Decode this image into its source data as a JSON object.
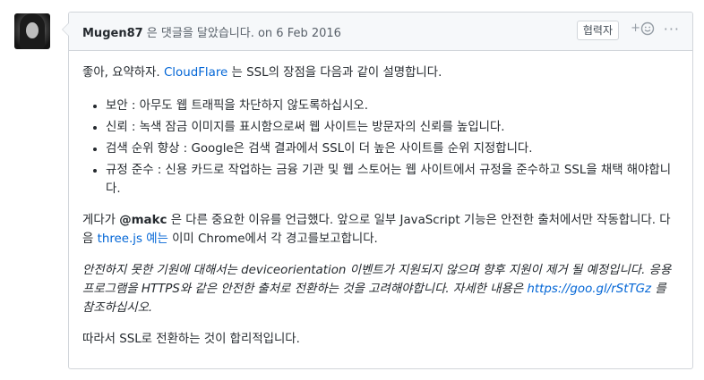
{
  "comment": {
    "author": "Mugen87",
    "action_text": " 은 댓글을 달았습니다. on 6 Feb 2016",
    "role_badge": "협력자",
    "reaction_plus": "+",
    "reaction_icon": "smiley-icon",
    "more_label": "···"
  },
  "body": {
    "intro_pre": "좋아, 요약하자. ",
    "intro_link": "CloudFlare",
    "intro_post": " 는 SSL의 장점을 다음과 같이 설명합니다.",
    "bullets": [
      "보안 : 아무도 웹 트래픽을 차단하지 않도록하십시오.",
      "신뢰 : 녹색 잠금 이미지를 표시함으로써 웹 사이트는 방문자의 신뢰를 높입니다.",
      "검색 순위 향상 : Google은 검색 결과에서 SSL이 더 높은 사이트를 순위 지정합니다.",
      "규정 준수 : 신용 카드로 작업하는 금융 기관 및 웹 스토어는 웹 사이트에서 규정을 준수하고 SSL을 채택 해야합니다."
    ],
    "para2_pre": "게다가 ",
    "para2_mention": "@makc",
    "para2_mid": " 은 다른 중요한 이유를 언급했다. 앞으로 일부 JavaScript 기능은 안전한 출처에서만 작동합니다. 다음 ",
    "para2_link": "three.js 예는",
    "para2_post": " 이미 Chrome에서 각 경고를보고합니다.",
    "para3_text": "안전하지 못한 기원에 대해서는 deviceorientation 이벤트가 지원되지 않으며 향후 지원이 제거 될 예정입니다. 응용 프로그램을 HTTPS와 같은 안전한 출처로 전환하는 것을 고려해야합니다. 자세한 내용은 ",
    "para3_link": "https://goo.gl/rStTGz",
    "para3_post": " 를 참조하십시오.",
    "para4": "따라서 SSL로 전환하는 것이 합리적입니다."
  }
}
